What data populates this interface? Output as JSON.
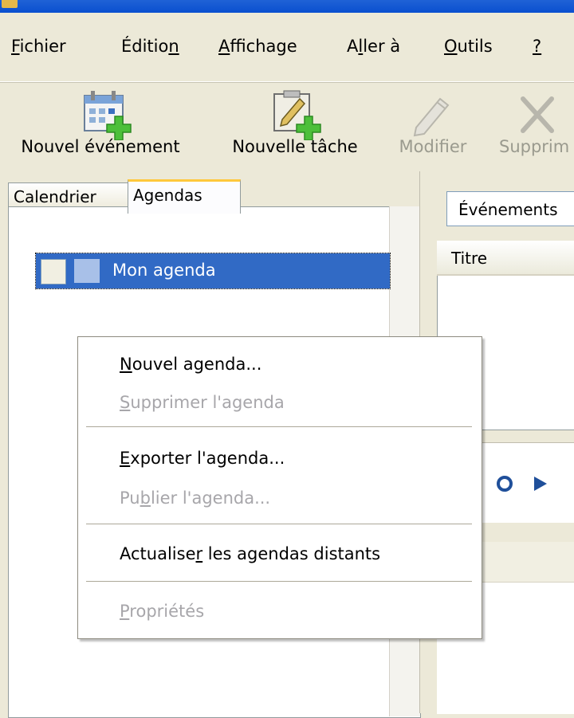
{
  "menubar": {
    "items": [
      {
        "label_ul": "F",
        "label_rest": "ichier"
      },
      {
        "label_pre": "Éditio",
        "label_ul": "n",
        "label_rest": ""
      },
      {
        "label_ul": "A",
        "label_rest": "ffichage"
      },
      {
        "label_pre": "A",
        "label_ul": "l",
        "label_rest": "ler à"
      },
      {
        "label_ul": "O",
        "label_rest": "utils"
      },
      {
        "label_ul": "?",
        "label_rest": ""
      }
    ]
  },
  "toolbar": {
    "new_event": "Nouvel événement",
    "new_task": "Nouvelle tâche",
    "edit": "Modifier",
    "delete": "Supprim"
  },
  "tabs": {
    "calendar": "Calendrier",
    "agendas": "Agendas"
  },
  "agendas_list": [
    {
      "name": "Mon agenda",
      "selected": true,
      "checked": false,
      "color": "#a8c0e8"
    }
  ],
  "filter": {
    "selected": "Événements"
  },
  "event_list": {
    "column_title": "Titre"
  },
  "context_menu": {
    "items": [
      {
        "ul": "N",
        "rest": "ouvel agenda...",
        "enabled": true
      },
      {
        "ul": "S",
        "rest": "upprimer l'agenda",
        "enabled": false
      },
      {
        "ul": "E",
        "rest": "xporter l'agenda...",
        "enabled": true
      },
      {
        "pre": "Pu",
        "ul": "b",
        "rest": "lier l'agenda...",
        "enabled": false
      },
      {
        "pre": "Actualise",
        "ul": "r",
        "rest": " les agendas distants",
        "enabled": true
      },
      {
        "ul": "P",
        "rest": "ropriétés",
        "enabled": false
      }
    ]
  },
  "colors": {
    "selection": "#316ac5",
    "menu_border": "#8d8b80",
    "disabled_text": "#a7a6aa",
    "window_bg": "#ece9d8"
  }
}
